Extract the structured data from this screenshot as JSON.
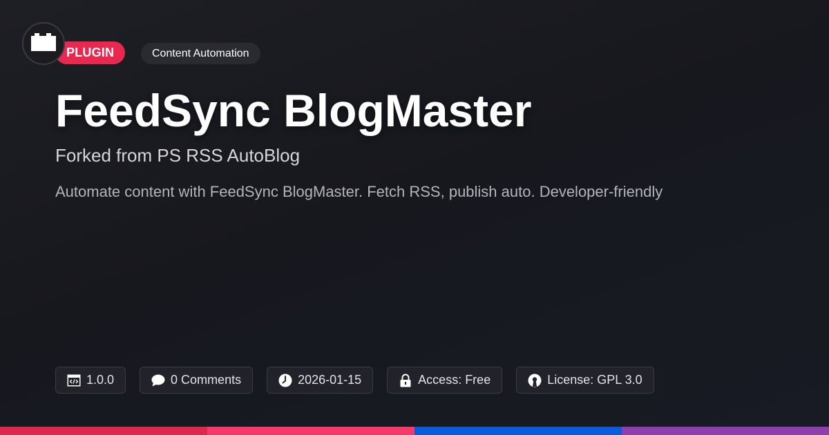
{
  "header": {
    "logo_icon": "plugin-block-icon",
    "type_badge": "PLUGIN",
    "category_badge": "Content Automation"
  },
  "title": "FeedSync BlogMaster",
  "subtitle": "Forked from PS RSS AutoBlog",
  "description": "Automate content with FeedSync BlogMaster. Fetch RSS, publish auto. Developer-friendly",
  "meta": {
    "version": "1.0.0",
    "comments": "0 Comments",
    "date": "2026-01-15",
    "access": "Access: Free",
    "license": "License: GPL 3.0"
  },
  "colors": {
    "accent_pink": "#e8284f",
    "bar": [
      "#e0284f",
      "#f53a6a",
      "#0a5bde",
      "#8e3ead"
    ]
  }
}
